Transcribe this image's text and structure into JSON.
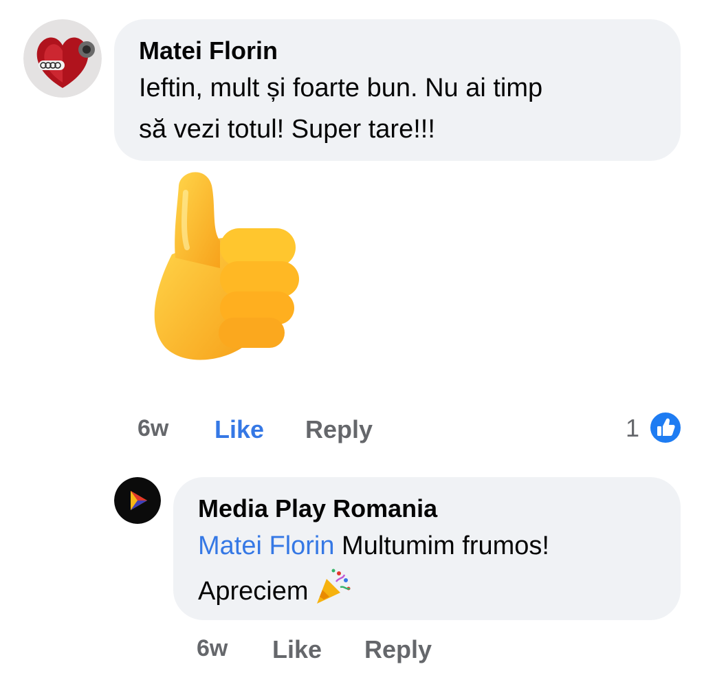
{
  "comment": {
    "author": "Matei Florin",
    "text_line1": "Ieftin, mult și foarte bun. Nu ai timp",
    "text_line2": "să vezi totul! Super tare!!!",
    "sticker_icon": "thumbs-up-sticker-icon",
    "time": "6w",
    "like_label": "Like",
    "reply_label": "Reply",
    "reaction_count": "1",
    "reaction_icon": "like-reaction-icon",
    "like_color": "#3578e5"
  },
  "reply": {
    "author": "Media Play Romania",
    "mention": "Matei Florin",
    "text_part1": " Multumim frumos!",
    "text_line2": "Apreciem",
    "emoji_icon": "party-popper-icon",
    "time": "6w",
    "like_label": "Like",
    "reply_label": "Reply"
  },
  "colors": {
    "bubble_bg": "#f0f2f5",
    "meta_gray": "#65676b",
    "accent_blue": "#3578e5"
  }
}
